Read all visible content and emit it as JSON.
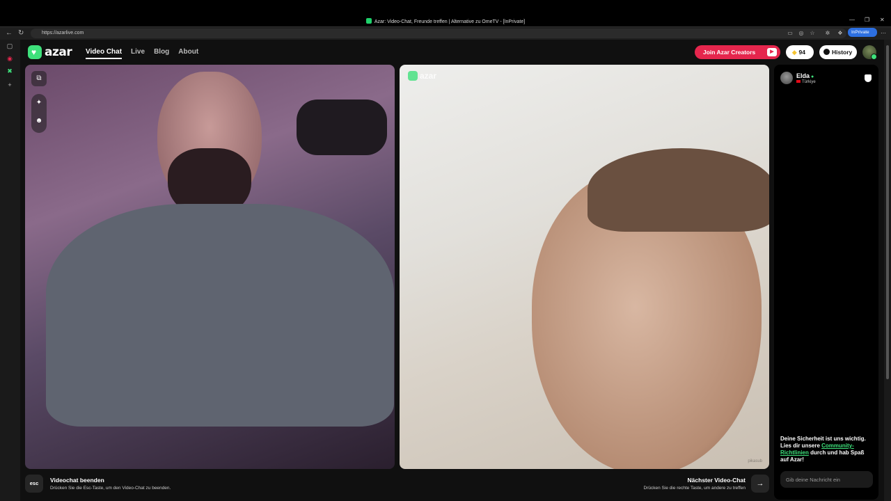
{
  "browser": {
    "window_title": "Azar: Video-Chat, Freunde treffen | Alternative zu OmeTV - [InPrivate]",
    "url": "https://azarlive.com",
    "inprivate_label": "InPrivate"
  },
  "site": {
    "logo_text": "azar",
    "nav": [
      "Video Chat",
      "Live",
      "Blog",
      "About"
    ],
    "creators_label": "Join Azar Creators",
    "gems_count": "94",
    "history_label": "History"
  },
  "remote_video": {
    "watermark": "azar",
    "corner_mark": "pikasub"
  },
  "chat": {
    "partner_name": "Elda",
    "partner_country": "Türkiye",
    "safety_text_1": "Deine Sicherheit ist uns wichtig. Lies dir unsere ",
    "safety_link": "Community-Richtlinien",
    "safety_text_2": " durch und hab Spaß auf Azar!",
    "message_placeholder": "Gib deine Nachricht ein"
  },
  "footer": {
    "esc_key": "esc",
    "end_title": "Videochat beenden",
    "end_sub": "Drücken Sie die Esc-Taste, um den Video-Chat zu beenden.",
    "next_title": "Nächster Video-Chat",
    "next_sub": "Drücken Sie die rechte Taste, um andere zu treffen"
  },
  "colors": {
    "brand_green": "#3ee07b",
    "creators_red": "#e5264d",
    "page_bg": "#101010"
  }
}
